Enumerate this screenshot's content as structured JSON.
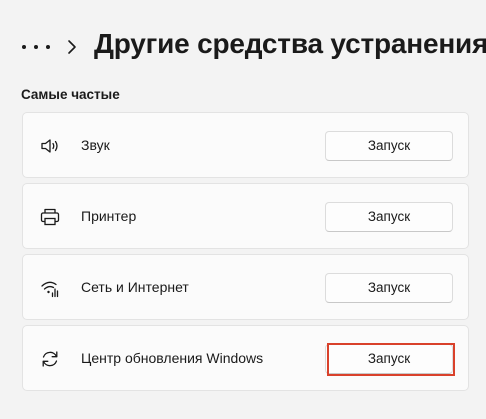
{
  "header": {
    "title": "Другие средства устранения"
  },
  "section": {
    "heading": "Самые частые"
  },
  "items": [
    {
      "label": "Звук",
      "icon": "speaker-icon",
      "button": "Запуск"
    },
    {
      "label": "Принтер",
      "icon": "printer-icon",
      "button": "Запуск"
    },
    {
      "label": "Сеть и Интернет",
      "icon": "network-icon",
      "button": "Запуск"
    },
    {
      "label": "Центр обновления Windows",
      "icon": "refresh-icon",
      "button": "Запуск"
    }
  ],
  "colors": {
    "background": "#f3f3f3",
    "card": "#fbfbfb",
    "highlight": "#d9412b"
  }
}
